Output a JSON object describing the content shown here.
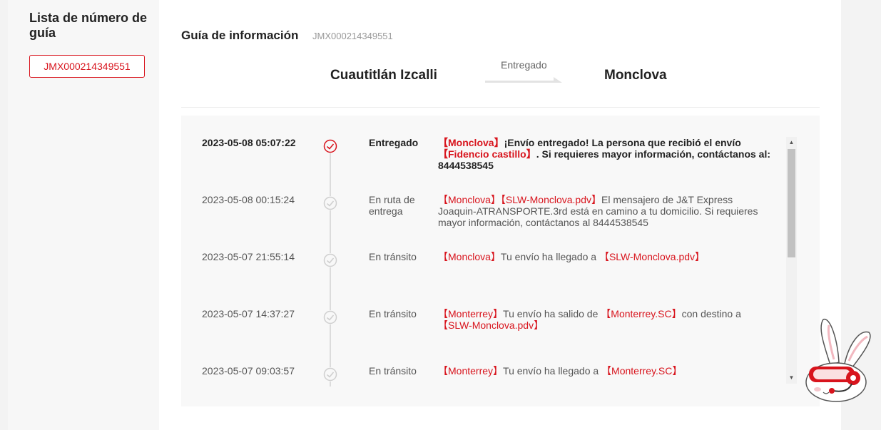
{
  "sidebar": {
    "title": "Lista de número de guía",
    "tracking_number": "JMX000214349551"
  },
  "info": {
    "title": "Guía de información",
    "number": "JMX000214349551"
  },
  "route": {
    "origin": "Cuautitlán Izcalli",
    "status": "Entregado",
    "destination": "Monclova"
  },
  "colors": {
    "accent": "#d8141d",
    "timeline": "#dcdcdc"
  },
  "events": [
    {
      "time": "2023-05-08 05:07:22",
      "status": "Entregado",
      "icon": "check-circle-icon",
      "desc": [
        {
          "t": "【Monclova】",
          "red": true
        },
        {
          "t": "¡Envío entregado! La persona que recibió el envío ",
          "red": false
        },
        {
          "t": "【Fidencio castillo】",
          "red": true
        },
        {
          "t": ". Si requieres mayor información, contáctanos al: 8444538545",
          "red": false
        }
      ]
    },
    {
      "time": "2023-05-08 00:15:24",
      "status": "En ruta de entrega",
      "icon": "check-circle-icon",
      "desc": [
        {
          "t": "【Monclova】",
          "red": true
        },
        {
          "t": "【SLW-Monclova.pdv】",
          "red": true
        },
        {
          "t": "El mensajero de J&T Express Joaquin-ATRANSPORTE.3rd está en camino a tu domicilio. Si requieres mayor información, contáctanos al 8444538545",
          "red": false
        }
      ]
    },
    {
      "time": "2023-05-07 21:55:14",
      "status": "En tránsito",
      "icon": "check-circle-icon",
      "desc": [
        {
          "t": "【Monclova】",
          "red": true
        },
        {
          "t": "Tu envío ha llegado a ",
          "red": false
        },
        {
          "t": "【SLW-Monclova.pdv】",
          "red": true
        }
      ]
    },
    {
      "time": "2023-05-07 14:37:27",
      "status": "En tránsito",
      "icon": "check-circle-icon",
      "desc": [
        {
          "t": "【Monterrey】",
          "red": true
        },
        {
          "t": "Tu envío ha salido de ",
          "red": false
        },
        {
          "t": "【Monterrey.SC】",
          "red": true
        },
        {
          "t": "con destino a ",
          "red": false
        },
        {
          "t": "【SLW-Monclova.pdv】",
          "red": true
        }
      ]
    },
    {
      "time": "2023-05-07 09:03:57",
      "status": "En tránsito",
      "icon": "check-circle-icon",
      "desc": [
        {
          "t": "【Monterrey】",
          "red": true
        },
        {
          "t": "Tu envío ha llegado a ",
          "red": false
        },
        {
          "t": "【Monterrey.SC】",
          "red": true
        }
      ]
    }
  ],
  "scrollbar": {
    "position_fraction": 0.0,
    "up_icon": "scroll-up-arrow-icon",
    "down_icon": "scroll-down-arrow-icon"
  },
  "mascot": {
    "icon": "rabbit-mascot-icon"
  }
}
